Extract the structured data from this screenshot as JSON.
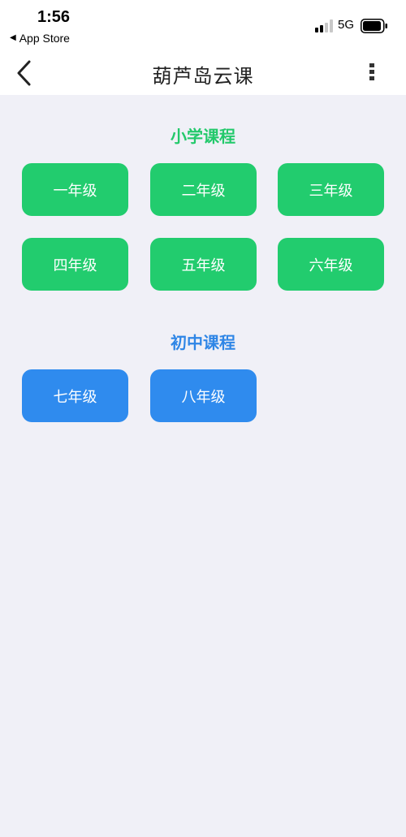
{
  "status_bar": {
    "time": "1:56",
    "back_app_label": "App Store",
    "network": "5G"
  },
  "nav": {
    "title": "葫芦岛云课"
  },
  "sections": [
    {
      "title": "小学课程",
      "color": "#23c96b",
      "grades": [
        "一年级",
        "二年级",
        "三年级",
        "四年级",
        "五年级",
        "六年级"
      ]
    },
    {
      "title": "初中课程",
      "color": "#2f86e6",
      "grades": [
        "七年级",
        "八年级"
      ]
    }
  ],
  "colors": {
    "primary_green": "#22cc6e",
    "junior_blue": "#2f8bee",
    "background": "#f0f0f7"
  },
  "icons": {
    "back": "chevron-left-icon",
    "more": "more-vertical-icon",
    "signal": "cellular-signal-icon",
    "battery": "battery-icon"
  }
}
